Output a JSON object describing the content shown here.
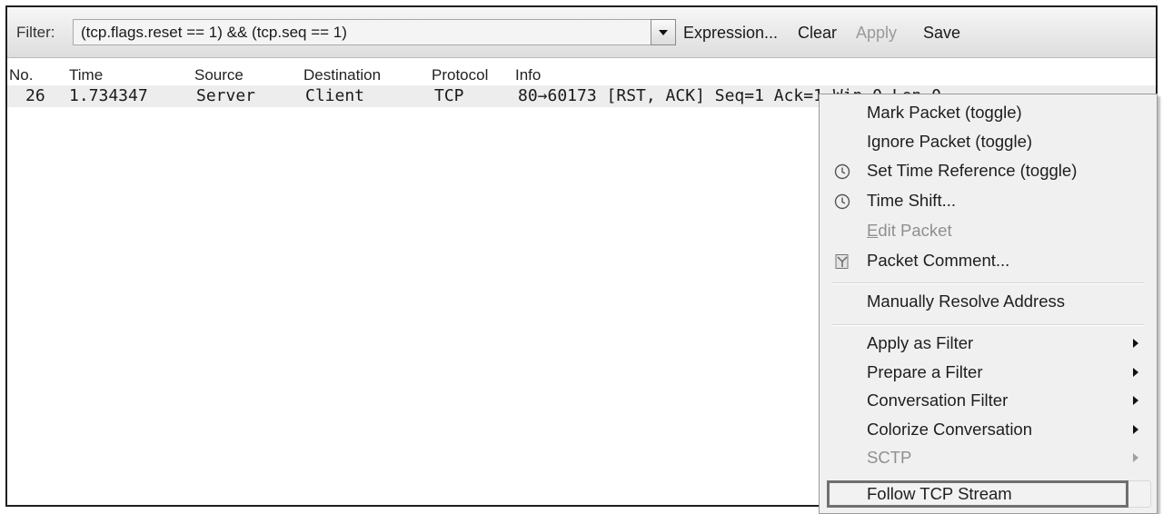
{
  "toolbar": {
    "filter_label": "Filter:",
    "filter_value": "(tcp.flags.reset == 1) && (tcp.seq == 1)",
    "expression_label": "Expression...",
    "clear_label": "Clear",
    "apply_label": "Apply",
    "save_label": "Save"
  },
  "packet_list": {
    "columns": [
      "No.",
      "Time",
      "Source",
      "Destination",
      "Protocol",
      "Info"
    ],
    "rows": [
      {
        "no": "26",
        "time": "1.734347",
        "source": "Server",
        "destination": "Client",
        "protocol": "TCP",
        "info": "80→60173 [RST, ACK] Seq=1 Ack=1 Win=0 Len=0"
      }
    ]
  },
  "context_menu": {
    "items": [
      {
        "label": "Mark Packet (toggle)",
        "icon": null,
        "enabled": true
      },
      {
        "label": "Ignore Packet (toggle)",
        "icon": null,
        "enabled": true
      },
      {
        "label": "Set Time Reference (toggle)",
        "icon": "clock-icon",
        "enabled": true
      },
      {
        "label": "Time Shift...",
        "icon": "clock-icon",
        "enabled": true
      },
      {
        "label_mnemonic": "E",
        "label_rest": "dit Packet",
        "label": "Edit Packet",
        "icon": null,
        "enabled": false
      },
      {
        "label": "Packet Comment...",
        "icon": "comment-icon",
        "enabled": true
      },
      {
        "label": "Manually Resolve Address",
        "icon": null,
        "enabled": true
      },
      {
        "label": "Apply as Filter",
        "submenu": true,
        "enabled": true
      },
      {
        "label": "Prepare a Filter",
        "submenu": true,
        "enabled": true
      },
      {
        "label": "Conversation Filter",
        "submenu": true,
        "enabled": true
      },
      {
        "label": "Colorize Conversation",
        "submenu": true,
        "enabled": true
      },
      {
        "label": "SCTP",
        "submenu": true,
        "enabled": false
      },
      {
        "label": "Follow TCP Stream",
        "enabled": true,
        "highlighted": true
      }
    ]
  },
  "colors": {
    "highlight_border": "#6f6f6f",
    "disabled_text": "#8f8f8f",
    "row_background": "#ededed"
  }
}
